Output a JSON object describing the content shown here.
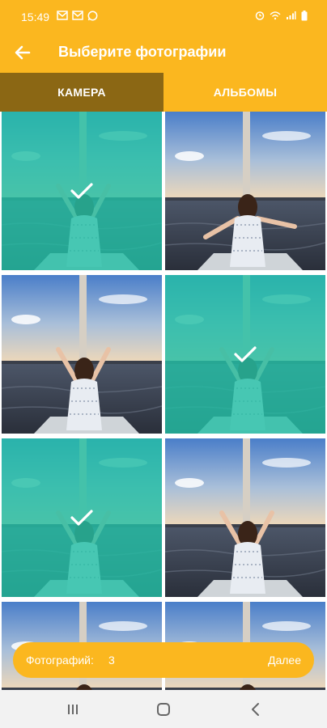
{
  "status_bar": {
    "time": "15:49",
    "left_icons": [
      "mail-icon",
      "mail-icon",
      "whatsapp-icon"
    ],
    "right_icons": [
      "alarm-icon",
      "vowifi-icon",
      "signal-icon",
      "battery-icon"
    ]
  },
  "app_bar": {
    "back_icon": "arrow-left-icon",
    "title": "Выберите фотографии"
  },
  "tabs": [
    {
      "label": "КАМЕРА",
      "active": true
    },
    {
      "label": "АЛЬБОМЫ",
      "active": false
    }
  ],
  "photos": [
    {
      "pose": "arms-up",
      "selected": true
    },
    {
      "pose": "arms-out",
      "selected": false
    },
    {
      "pose": "arms-up",
      "selected": false
    },
    {
      "pose": "arms-up",
      "selected": true
    },
    {
      "pose": "arms-up",
      "selected": true
    },
    {
      "pose": "arms-up",
      "selected": false
    },
    {
      "pose": "arms-out",
      "selected": false
    },
    {
      "pose": "arms-out",
      "selected": false
    }
  ],
  "bottom_bar": {
    "count_label": "Фотографий:",
    "count": "3",
    "next_label": "Далее"
  },
  "nav_bar": {
    "buttons": [
      "recent-apps-icon",
      "home-icon",
      "back-icon"
    ]
  },
  "colors": {
    "accent": "#fbb71f",
    "tab_active": "#8b6714",
    "selection_overlay": "#23bea5"
  }
}
